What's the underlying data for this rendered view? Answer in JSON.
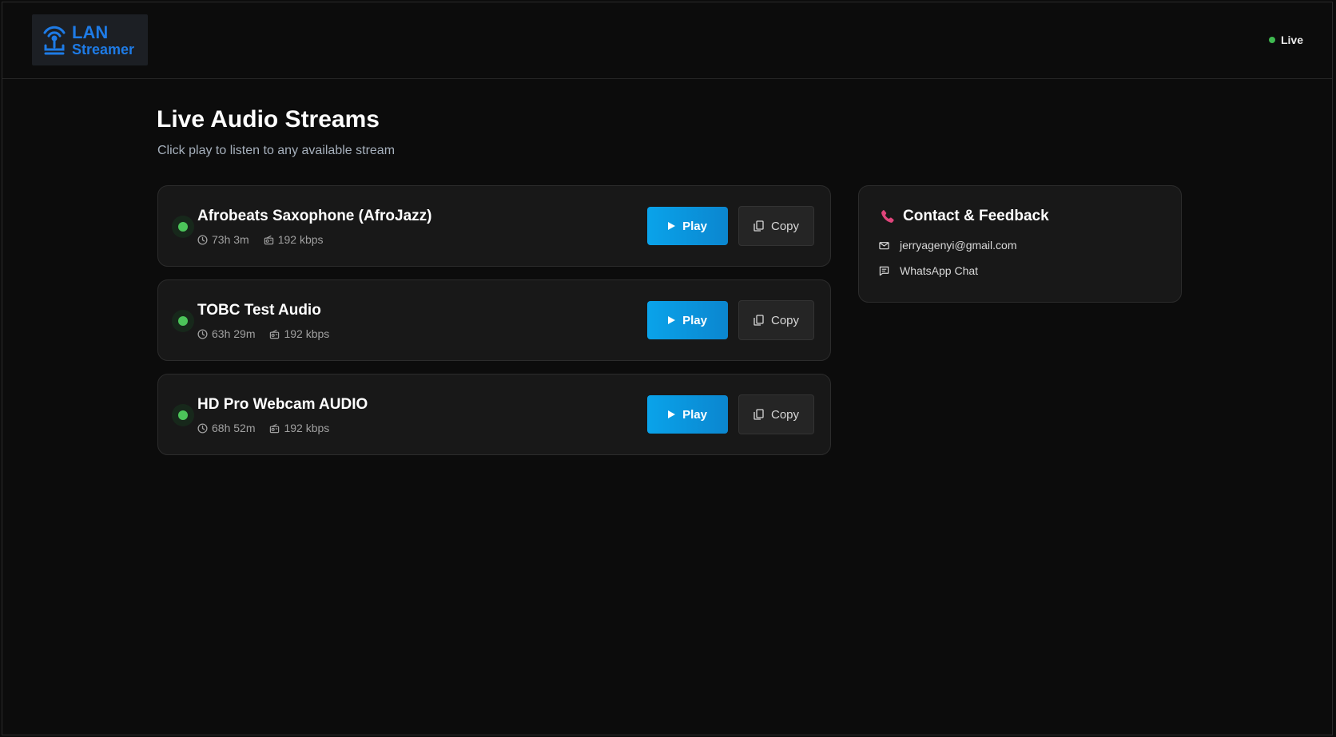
{
  "header": {
    "logo_line1": "LAN",
    "logo_line2": "Streamer",
    "live_label": "Live"
  },
  "main": {
    "title": "Live Audio Streams",
    "subtitle": "Click play to listen to any available stream"
  },
  "streams": [
    {
      "name": "Afrobeats Saxophone (AfroJazz)",
      "uptime": "73h 3m",
      "bitrate": "192 kbps",
      "play_label": "Play",
      "copy_label": "Copy"
    },
    {
      "name": "TOBC Test Audio",
      "uptime": "63h 29m",
      "bitrate": "192 kbps",
      "play_label": "Play",
      "copy_label": "Copy"
    },
    {
      "name": "HD Pro Webcam AUDIO",
      "uptime": "68h 52m",
      "bitrate": "192 kbps",
      "play_label": "Play",
      "copy_label": "Copy"
    }
  ],
  "contact": {
    "title": "Contact & Feedback",
    "email": "jerryagenyi@gmail.com",
    "whatsapp": "WhatsApp Chat"
  },
  "colors": {
    "accent_blue": "#0aa3ea",
    "logo_blue": "#1e7be6",
    "status_green": "#4cc45a",
    "phone_pink": "#e0457b",
    "background": "#0c0c0c",
    "card": "#181818"
  },
  "icons": {
    "logo": "broadcast-tower-icon",
    "uptime": "clock-icon",
    "bitrate": "radio-icon",
    "play": "play-icon",
    "copy": "copy-icon",
    "contact": "phone-icon",
    "email": "mail-icon",
    "chat": "chat-icon"
  }
}
